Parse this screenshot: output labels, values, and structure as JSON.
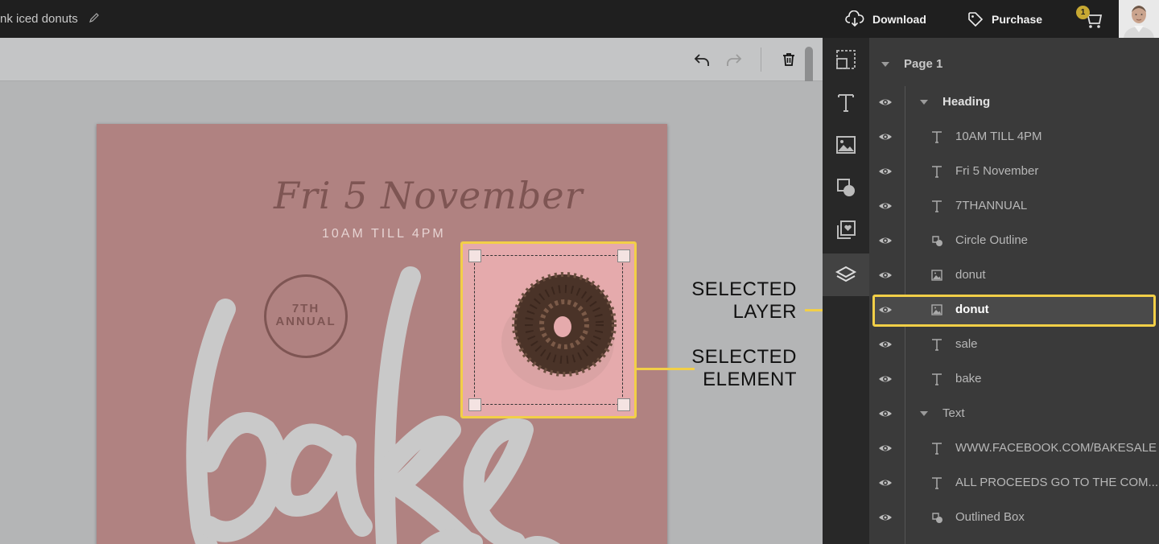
{
  "header": {
    "doc_title": "nk iced donuts",
    "download_label": "Download",
    "purchase_label": "Purchase",
    "cart_count": "1"
  },
  "poster": {
    "date_text": "Fri 5 November",
    "time_text": "10AM TILL 4PM",
    "annual_line1": "7TH",
    "annual_line2": "ANNUAL",
    "script_word": "bake"
  },
  "annotations": {
    "selected_layer_line1": "SELECTED",
    "selected_layer_line2": "LAYER",
    "selected_element_line1": "SELECTED",
    "selected_element_line2": "ELEMENT"
  },
  "layers": {
    "page_label": "Page 1",
    "groups": [
      {
        "name": "Heading",
        "items": [
          {
            "type": "text",
            "name": "10AM TILL 4PM"
          },
          {
            "type": "text",
            "name": "Fri 5 November"
          },
          {
            "type": "text",
            "name": "7THANNUAL"
          },
          {
            "type": "shape",
            "name": "Circle Outline"
          },
          {
            "type": "image",
            "name": "donut"
          },
          {
            "type": "image",
            "name": "donut",
            "selected": true
          },
          {
            "type": "text",
            "name": "sale"
          },
          {
            "type": "text",
            "name": "bake"
          }
        ]
      },
      {
        "name": "Text",
        "items": [
          {
            "type": "text",
            "name": "WWW.FACEBOOK.COM/BAKESALE"
          },
          {
            "type": "text",
            "name": "ALL PROCEEDS GO TO THE COM..."
          },
          {
            "type": "shape",
            "name": "Outlined Box"
          }
        ]
      }
    ]
  },
  "colors": {
    "accent": "#f2cf47",
    "poster_bg": "#b08281",
    "panel_bg": "#3a3a3a"
  }
}
